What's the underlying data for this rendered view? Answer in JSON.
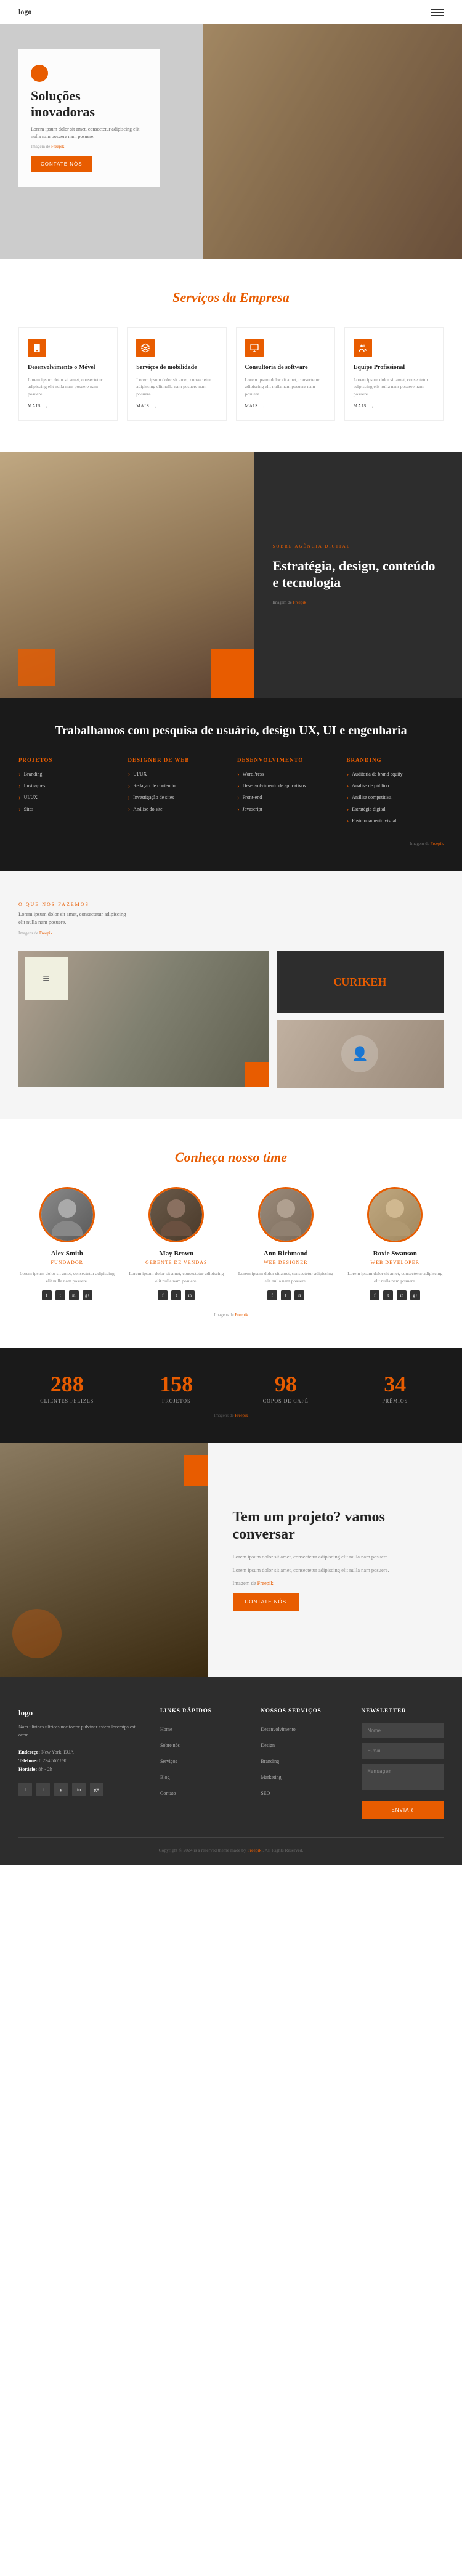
{
  "nav": {
    "logo": "logo",
    "menu_aria": "open menu"
  },
  "hero": {
    "dot_color": "#e85c00",
    "title": "Soluções inovadoras",
    "description": "Lorem ipsum dolor sit amet, consectetur adipiscing elit nulla nam posuere nam posuere.",
    "image_credit_text": "Imagem de Freepik",
    "image_credit_link": "Freepik",
    "cta_button": "CONTATE NÓS"
  },
  "services": {
    "section_title": "Serviços da Empresa",
    "cards": [
      {
        "title": "Desenvolvimento o Móvel",
        "description": "Lorem ipsum dolor sit amet, consectetur adipiscing elit nulla nam posuere nam posuere.",
        "more": "MAIS"
      },
      {
        "title": "Serviços de mobilidade",
        "description": "Lorem ipsum dolor sit amet, consectetur adipiscing elit nulla nam posuere nam posuere.",
        "more": "MAIS"
      },
      {
        "title": "Consultoria de software",
        "description": "Lorem ipsum dolor sit amet, consectetur adipiscing elit nulla nam posuere nam posuere.",
        "more": "MAIS"
      },
      {
        "title": "Equipe Profissional",
        "description": "Lorem ipsum dolor sit amet, consectetur adipiscing elit nulla nam posuere nam posuere.",
        "more": "MAIS"
      }
    ]
  },
  "agency": {
    "label": "SOBRE AGÊNCIA DIGITAL",
    "title": "Estratégia, design, conteúdo e tecnologia",
    "image_credit_text": "Imagem de Freepik",
    "image_credit_link": "Freepik"
  },
  "work": {
    "title": "Trabalhamos com pesquisa de usuário, design UX, UI e engenharia",
    "columns": [
      {
        "heading": "Projetos",
        "items": [
          "Branding",
          "Ilustrações",
          "UI/UX",
          "Sites"
        ]
      },
      {
        "heading": "Designer de Web",
        "items": [
          "UI/UX",
          "Redação de conteúdo",
          "Investigação de sites",
          "Análise do site"
        ]
      },
      {
        "heading": "Desenvolvimento",
        "items": [
          "WordPress",
          "Desenvolvimento de aplicativos",
          "Front-end",
          "Javascript"
        ]
      },
      {
        "heading": "Branding",
        "items": [
          "Auditoria de brand equity",
          "Análise de público",
          "Análise competitiva",
          "Estratégia digital",
          "Posicionamento visual"
        ]
      }
    ],
    "image_credit_text": "Imagem de Freepik",
    "image_credit_link": "Freepik"
  },
  "portfolio": {
    "label": "O QUE NÓS FAZEMOS",
    "description": "Lorem ipsum dolor sit amet, consectetur adipiscing elit nulla nam posuere.",
    "image_credit_text": "Imagens de Freepik",
    "image_credit_link": "Freepik",
    "logo_text": "CURIKEH",
    "logo_sub": "CURIKEH"
  },
  "team": {
    "section_title": "Conheça nosso time",
    "members": [
      {
        "name": "Alex Smith",
        "role": "Fundador",
        "description": "Lorem ipsum dolor sit amet, consectetur adipiscing elit nulla nam posuere.",
        "socials": [
          "f",
          "t",
          "in",
          "g+"
        ]
      },
      {
        "name": "May Brown",
        "role": "Gerente de vendas",
        "description": "Lorem ipsum dolor sit amet, consectetur adipiscing elit nulla nam posuere.",
        "socials": [
          "f",
          "t",
          "in"
        ]
      },
      {
        "name": "Ann Richmond",
        "role": "Web Designer",
        "description": "Lorem ipsum dolor sit amet, consectetur adipiscing elit nulla nam posuere.",
        "socials": [
          "f",
          "t",
          "in"
        ]
      },
      {
        "name": "Roxie Swanson",
        "role": "Web Developer",
        "description": "Lorem ipsum dolor sit amet, consectetur adipiscing elit nulla nam posuere.",
        "socials": [
          "f",
          "t",
          "in",
          "g+"
        ]
      }
    ],
    "image_credit_text": "Imagens de Freepik",
    "image_credit_link": "Freepik"
  },
  "stats": {
    "items": [
      {
        "number": "288",
        "label": "CLIENTES FELIZES"
      },
      {
        "number": "158",
        "label": "PROJETOS"
      },
      {
        "number": "98",
        "label": "COPOS DE CAFÉ"
      },
      {
        "number": "34",
        "label": "PRÊMIOS"
      }
    ],
    "image_credit_text": "Imagens de Freepik",
    "image_credit_link": "Freepik"
  },
  "project_cta": {
    "title": "Tem um projeto? vamos conversar",
    "description1": "Lorem ipsum dolor sit amet, consectetur adipiscing elit nulla nam posuere.",
    "description2": "Lorem ipsum dolor sit amet, consectetur adipiscing elit nulla nam posuere.",
    "image_credit_text": "Imagem de Freepik",
    "image_credit_link": "Freepik",
    "cta_button": "CONTATE NÓS"
  },
  "footer": {
    "brand_description": "Nam ultrices ultrices nec tortor pulvinar estera loremips est orem.",
    "address_label": "Endereço:",
    "address_value": "New York, EUA",
    "phone_label": "Telefone:",
    "phone_value": "0 234 567 890",
    "hours_label": "Horário:",
    "hours_value": "8h - 2h",
    "columns": [
      {
        "heading": "Links Rápidos",
        "items": [
          "Home",
          "Sobre nós",
          "Serviços",
          "Blog",
          "Contato"
        ]
      },
      {
        "heading": "Nossos Serviços",
        "items": [
          "Desenvolvimento",
          "Design",
          "Branding",
          "Marketing",
          "SEO"
        ]
      }
    ],
    "form": {
      "heading": "Newsletter",
      "name_placeholder": "Nome",
      "email_placeholder": "E-mail",
      "message_placeholder": "Mensagem",
      "submit_label": "ENVIAR"
    },
    "socials": [
      "f",
      "t",
      "y",
      "in",
      "g+"
    ],
    "copyright": "Copyright © 2024 is a reserved theme made by",
    "copyright_link": "Freepik",
    "copyright_end": ". All Rights Reserved."
  }
}
